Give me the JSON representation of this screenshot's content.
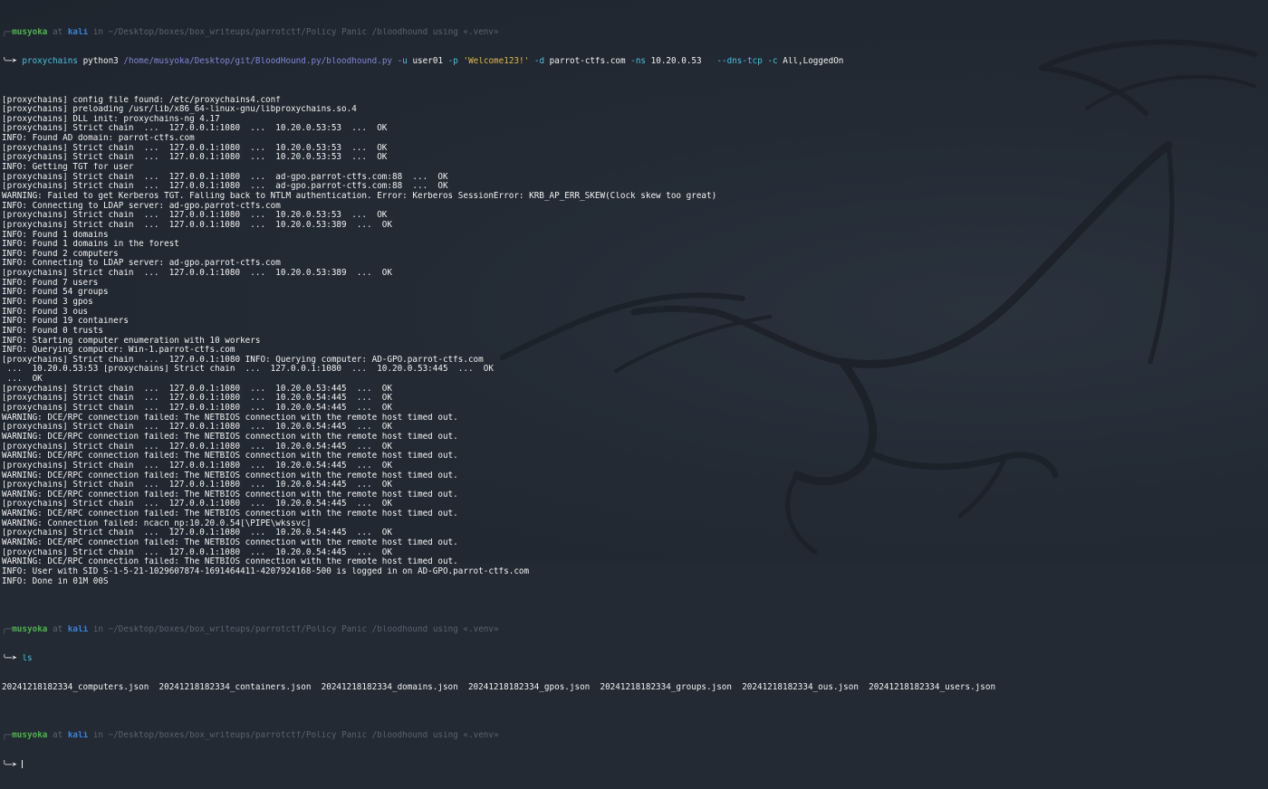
{
  "colors": {
    "background": "#232a34",
    "prompt_user": "#4fb34c",
    "prompt_host": "#3c80d8",
    "prompt_dim": "#5a6270",
    "command": "#49c0e4",
    "path": "#7f87d6",
    "string": "#e0b94a",
    "output": "#f2f2f2"
  },
  "prompts": [
    {
      "user": "musyoka",
      "at": "at",
      "host": "kali",
      "rest": "in ~/Desktop/boxes/box_writeups/parrotctf/Policy Panic /bloodhound using «.venv»"
    },
    {
      "user": "musyoka",
      "at": "at",
      "host": "kali",
      "rest": "in ~/Desktop/boxes/box_writeups/parrotctf/Policy Panic /bloodhound using «.venv»"
    },
    {
      "user": "musyoka",
      "at": "at",
      "host": "kali",
      "rest": "in ~/Desktop/boxes/box_writeups/parrotctf/Policy Panic /bloodhound using «.venv»"
    }
  ],
  "command1": {
    "arrow": "╰─➤ ",
    "proxychains": "proxychains",
    "python": "python3",
    "script": "/home/musyoka/Desktop/git/BloodHound.py/bloodhound.py",
    "flag_u": "-u",
    "user": "user01",
    "flag_p": "-p",
    "password": "'Welcome123!'",
    "flag_d": "-d",
    "domain": "parrot-ctfs.com",
    "flag_ns": "-ns",
    "ns": "10.20.0.53",
    "flag_dns": "--dns-tcp",
    "flag_c": "-c",
    "collect": "All,LoggedOn"
  },
  "output1": [
    "[proxychains] config file found: /etc/proxychains4.conf",
    "[proxychains] preloading /usr/lib/x86_64-linux-gnu/libproxychains.so.4",
    "[proxychains] DLL init: proxychains-ng 4.17",
    "[proxychains] Strict chain  ...  127.0.0.1:1080  ...  10.20.0.53:53  ...  OK",
    "INFO: Found AD domain: parrot-ctfs.com",
    "[proxychains] Strict chain  ...  127.0.0.1:1080  ...  10.20.0.53:53  ...  OK",
    "[proxychains] Strict chain  ...  127.0.0.1:1080  ...  10.20.0.53:53  ...  OK",
    "INFO: Getting TGT for user",
    "[proxychains] Strict chain  ...  127.0.0.1:1080  ...  ad-gpo.parrot-ctfs.com:88  ...  OK",
    "[proxychains] Strict chain  ...  127.0.0.1:1080  ...  ad-gpo.parrot-ctfs.com:88  ...  OK",
    "WARNING: Failed to get Kerberos TGT. Falling back to NTLM authentication. Error: Kerberos SessionError: KRB_AP_ERR_SKEW(Clock skew too great)",
    "INFO: Connecting to LDAP server: ad-gpo.parrot-ctfs.com",
    "[proxychains] Strict chain  ...  127.0.0.1:1080  ...  10.20.0.53:53  ...  OK",
    "[proxychains] Strict chain  ...  127.0.0.1:1080  ...  10.20.0.53:389  ...  OK",
    "INFO: Found 1 domains",
    "INFO: Found 1 domains in the forest",
    "INFO: Found 2 computers",
    "INFO: Connecting to LDAP server: ad-gpo.parrot-ctfs.com",
    "[proxychains] Strict chain  ...  127.0.0.1:1080  ...  10.20.0.53:389  ...  OK",
    "INFO: Found 7 users",
    "INFO: Found 54 groups",
    "INFO: Found 3 gpos",
    "INFO: Found 3 ous",
    "INFO: Found 19 containers",
    "INFO: Found 0 trusts",
    "INFO: Starting computer enumeration with 10 workers",
    "INFO: Querying computer: Win-1.parrot-ctfs.com",
    "[proxychains] Strict chain  ...  127.0.0.1:1080 INFO: Querying computer: AD-GPO.parrot-ctfs.com",
    " ...  10.20.0.53:53 [proxychains] Strict chain  ...  127.0.0.1:1080  ...  10.20.0.53:445  ...  OK",
    " ...  OK",
    "[proxychains] Strict chain  ...  127.0.0.1:1080  ...  10.20.0.53:445  ...  OK",
    "[proxychains] Strict chain  ...  127.0.0.1:1080  ...  10.20.0.54:445  ...  OK",
    "[proxychains] Strict chain  ...  127.0.0.1:1080  ...  10.20.0.54:445  ...  OK",
    "WARNING: DCE/RPC connection failed: The NETBIOS connection with the remote host timed out.",
    "[proxychains] Strict chain  ...  127.0.0.1:1080  ...  10.20.0.54:445  ...  OK",
    "WARNING: DCE/RPC connection failed: The NETBIOS connection with the remote host timed out.",
    "[proxychains] Strict chain  ...  127.0.0.1:1080  ...  10.20.0.54:445  ...  OK",
    "WARNING: DCE/RPC connection failed: The NETBIOS connection with the remote host timed out.",
    "[proxychains] Strict chain  ...  127.0.0.1:1080  ...  10.20.0.54:445  ...  OK",
    "WARNING: DCE/RPC connection failed: The NETBIOS connection with the remote host timed out.",
    "[proxychains] Strict chain  ...  127.0.0.1:1080  ...  10.20.0.54:445  ...  OK",
    "WARNING: DCE/RPC connection failed: The NETBIOS connection with the remote host timed out.",
    "[proxychains] Strict chain  ...  127.0.0.1:1080  ...  10.20.0.54:445  ...  OK",
    "WARNING: DCE/RPC connection failed: The NETBIOS connection with the remote host timed out.",
    "WARNING: Connection failed: ncacn_np:10.20.0.54[\\PIPE\\wkssvc]",
    "[proxychains] Strict chain  ...  127.0.0.1:1080  ...  10.20.0.54:445  ...  OK",
    "WARNING: DCE/RPC connection failed: The NETBIOS connection with the remote host timed out.",
    "[proxychains] Strict chain  ...  127.0.0.1:1080  ...  10.20.0.54:445  ...  OK",
    "WARNING: DCE/RPC connection failed: The NETBIOS connection with the remote host timed out.",
    "INFO: User with SID S-1-5-21-1029607874-1691464411-4207924168-500 is logged in on AD-GPO.parrot-ctfs.com",
    "INFO: Done in 01M 00S"
  ],
  "command2": {
    "arrow": "╰─➤ ",
    "cmd": "ls"
  },
  "output2": "20241218182334_computers.json  20241218182334_containers.json  20241218182334_domains.json  20241218182334_gpos.json  20241218182334_groups.json  20241218182334_ous.json  20241218182334_users.json",
  "command3": {
    "arrow": "╰─➤ "
  }
}
